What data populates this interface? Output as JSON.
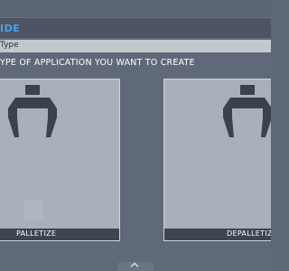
{
  "header": {
    "title": "IDE"
  },
  "breadcrumb": {
    "label": "Type"
  },
  "instruction": {
    "text": "YPE OF APPLICATION YOU WANT TO CREATE"
  },
  "cards": [
    {
      "label": "PALLETIZE",
      "icon": "gripper-icon"
    },
    {
      "label": "DEPALLETIZ",
      "icon": "gripper-icon"
    }
  ],
  "colors": {
    "accent": "#4f9fe6",
    "background": "#5f6979",
    "card": "#aab0bb",
    "card_label_bar": "#3e4450",
    "icon": "#3c424d"
  }
}
